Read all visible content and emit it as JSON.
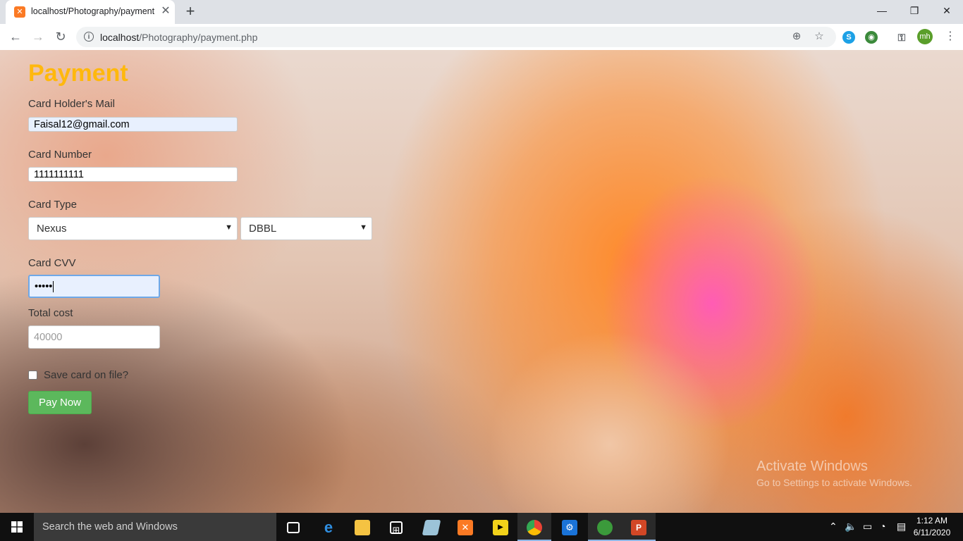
{
  "browser": {
    "tab_title": "localhost/Photography/payment",
    "tab_favicon": "xampp-icon",
    "url_host": "localhost",
    "url_path": "/Photography/payment.php",
    "extensions": [
      "skype-icon",
      "globe-icon",
      "key-icon"
    ],
    "profile_initials": "mh"
  },
  "form": {
    "heading": "Payment",
    "mail_label": "Card Holder's Mail",
    "mail_value": "Faisal12@gmail.com",
    "card_number_label": "Card Number",
    "card_number_value": "1111111111",
    "card_type_label": "Card Type",
    "card_type_selected": "Nexus",
    "bank_selected": "DBBL",
    "cvv_label": "Card CVV",
    "cvv_value": "•••••",
    "total_label": "Total cost",
    "total_placeholder": "40000",
    "save_card_label": "Save card on file?",
    "save_card_checked": false,
    "pay_button": "Pay Now"
  },
  "watermark": {
    "line1": "Activate Windows",
    "line2": "Go to Settings to activate Windows."
  },
  "taskbar": {
    "search_placeholder": "Search the web and Windows",
    "pinned": [
      "task-view-icon",
      "edge-icon",
      "file-explorer-icon",
      "store-icon",
      "unknown-app-icon",
      "xampp-icon",
      "player-icon",
      "chrome-icon",
      "settings-icon",
      "network-globe-icon",
      "powerpoint-icon"
    ],
    "time": "1:12 AM",
    "date": "6/11/2020"
  },
  "colors": {
    "heading": "#ffb80d",
    "pay_button": "#5cb85c",
    "taskbar": "#101010"
  }
}
